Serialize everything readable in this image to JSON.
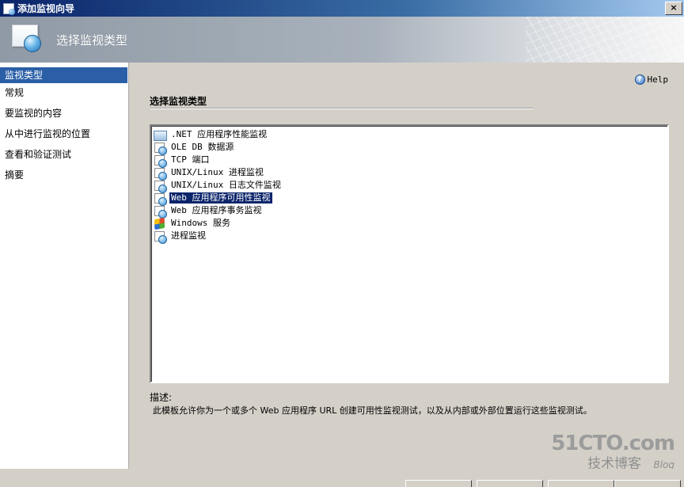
{
  "window": {
    "title": "添加监视向导",
    "close_glyph": "×"
  },
  "banner": {
    "title": "选择监视类型"
  },
  "nav": {
    "items": [
      {
        "label": "监视类型",
        "active": true
      },
      {
        "label": "常规"
      },
      {
        "label": "要监视的内容"
      },
      {
        "label": "从中进行监视的位置"
      },
      {
        "label": "查看和验证测试"
      },
      {
        "label": "摘要"
      }
    ]
  },
  "main": {
    "help_label": "Help",
    "section_title": "选择监视类型",
    "list": [
      {
        "label": ".NET 应用程序性能监视",
        "icon": "net-icon"
      },
      {
        "label": "OLE DB 数据源",
        "icon": "doc-icon"
      },
      {
        "label": "TCP 端口",
        "icon": "doc-icon"
      },
      {
        "label": "UNIX/Linux 进程监视",
        "icon": "doc-icon"
      },
      {
        "label": "UNIX/Linux 日志文件监视",
        "icon": "doc-icon"
      },
      {
        "label": "Web 应用程序可用性监视",
        "icon": "doc-icon",
        "selected": true
      },
      {
        "label": "Web 应用程序事务监视",
        "icon": "doc-icon"
      },
      {
        "label": "Windows 服务",
        "icon": "service-icon"
      },
      {
        "label": "进程监视",
        "icon": "doc-icon"
      }
    ],
    "description_label": "描述:",
    "description_text": "此模板允许你为一个或多个 Web 应用程序 URL 创建可用性监视测试，以及从内部或外部位置运行这些监视测试。"
  },
  "watermark": {
    "brand": "51CTO.com",
    "sub": "技术博客",
    "blog": "Blog"
  }
}
